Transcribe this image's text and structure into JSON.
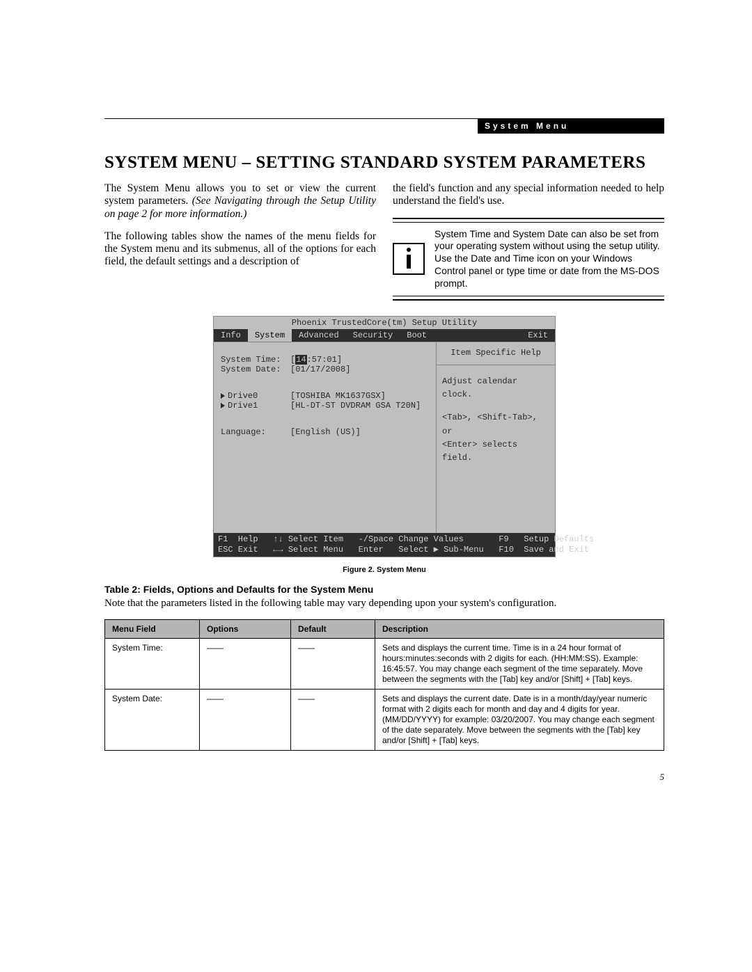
{
  "header": {
    "label": "System Menu"
  },
  "title": "SYSTEM MENU – SETTING STANDARD SYSTEM PARAMETERS",
  "intro": {
    "p1a": "The System Menu allows you to set or view the current system parameters. ",
    "p1b": "(See Navigating through the Setup Utility on page 2 for more information.)",
    "p2": "The following tables show the names of the menu fields for the System menu and its submenus, all of the options for each field, the default settings and a description of",
    "p3": "the field's function and any special information needed to help understand the field's use."
  },
  "info_panel": {
    "text": "System Time and System Date can also be set from your operating system without using the setup utility. Use the Date and Time icon on your Windows Control panel or type time or date from the MS-DOS prompt."
  },
  "bios": {
    "title": "Phoenix TrustedCore(tm) Setup Utility",
    "tabs": [
      "Info",
      "System",
      "Advanced",
      "Security",
      "Boot",
      "Exit"
    ],
    "active_tab": "System",
    "rows": {
      "time_label": "System Time:",
      "time_value_cursor": "14",
      "time_value_rest": ":57:01]",
      "date_label": "System Date:",
      "date_value": "[01/17/2008]",
      "drive0_label": "Drive0",
      "drive0_value": "[TOSHIBA MK1637GSX]",
      "drive1_label": "Drive1",
      "drive1_value": "[HL-DT-ST DVDRAM GSA T20N]",
      "lang_label": "Language:",
      "lang_value": "[English (US)]"
    },
    "help": {
      "title": "Item Specific Help",
      "l1": "Adjust calendar clock.",
      "l2": "<Tab>, <Shift-Tab>, or",
      "l3": "<Enter> selects field."
    },
    "footer": {
      "line1": "F1  Help   ↑↓ Select Item   -/Space Change Values       F9   Setup Defaults",
      "line2": "ESC Exit   ←→ Select Menu   Enter   Select ▶ Sub-Menu   F10  Save and Exit"
    }
  },
  "figure_caption": "Figure 2.  System Menu",
  "table_title": "Table 2: Fields, Options and Defaults for the System Menu",
  "table_note": "Note that the parameters listed in the following table may vary depending upon your system's configuration.",
  "table": {
    "headers": [
      "Menu Field",
      "Options",
      "Default",
      "Description"
    ],
    "rows": [
      {
        "field": "System Time:",
        "options": "——",
        "default": "——",
        "desc": "Sets and displays the current time. Time is in a 24 hour format of hours:minutes:seconds with 2 digits for each. (HH:MM:SS). Example: 16:45:57. You may change each segment of the time separately. Move between the segments with the [Tab] key and/or [Shift] + [Tab] keys."
      },
      {
        "field": "System Date:",
        "options": "——",
        "default": "——",
        "desc": "Sets and displays the current date. Date is in a month/day/year numeric format with 2 digits each for month and day and 4 digits for year. (MM/DD/YYYY) for example: 03/20/2007. You may change each segment of the date separately. Move between the segments with the [Tab] key and/or [Shift] + [Tab] keys."
      }
    ]
  },
  "page_number": "5"
}
